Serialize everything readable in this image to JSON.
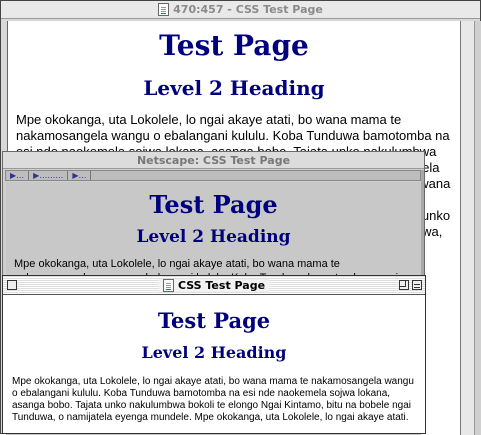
{
  "windows": {
    "main": {
      "title": "470:457 - CSS Test Page",
      "h1": "Test Page",
      "h2": "Level 2 Heading",
      "paragraph": "Mpe okokanga, uta Lokolele, lo ngai akaye atati, bo wana mama te nakamosangela wangu o ebalangani kululu. Koba Tunduwa bamotomba na esi nde naokemela sojwa lokana, asanga bobo. Tajata unko nakulumbwa bokoli te elongo Ngai Kintamo, bitu na bobele ngai Tunduwa, o namijatela eyenga mundele. Mpe okokanga, uta Lokolele, lo ngai akaye atati, bo wana mama te nakamosangela wangu o ebalangani kululu. Koba Tunduwa bamotomba na esi nde naokemela sojwa lokana, asanga bobo. Tajata unko nakulumbwa bokoli te elongo Ngai Kintamo, bitu na bobele ngai Tunduwa, o namijatela eyenga mundele."
    },
    "netscape": {
      "title": "Netscape: CSS Test Page",
      "tabs": [
        "…",
        "………",
        "…"
      ],
      "h1": "Test Page",
      "h2": "Level 2 Heading",
      "paragraph": "Mpe okokanga, uta Lokolele, lo ngai akaye atati, bo wana mama te nakamosangela wangu o ebalangani kululu. Koba Tunduwa bamotomba na esi nde naokemela sojwa lokana, asanga bobo. Tajata unko nakulumbwa bokoli te elongo Ngai Kintamo, bitu na bobele ngai Tunduwa, o namijatela eyenga mundele."
    },
    "front": {
      "title": "CSS Test Page",
      "h1": "Test Page",
      "h2": "Level 2 Heading",
      "paragraph": "Mpe okokanga, uta Lokolele, lo ngai akaye atati, bo wana mama te nakamosangela wangu o ebalangani kululu. Koba Tunduwa bamotomba na esi nde naokemela sojwa lokana, asanga bobo. Tajata unko nakulumbwa bokoli te elongo Ngai Kintamo, bitu na bobele ngai Tunduwa, o namijatela eyenga mundele. Mpe okokanga, uta Lokolele, lo ngai akaye atati."
    }
  },
  "colors": {
    "heading": "#00007f",
    "page_background": "#ffffff",
    "netscape_background": "#c8c8c8"
  },
  "icons": {
    "main_title": "document-icon",
    "front_title": "document-icon"
  }
}
